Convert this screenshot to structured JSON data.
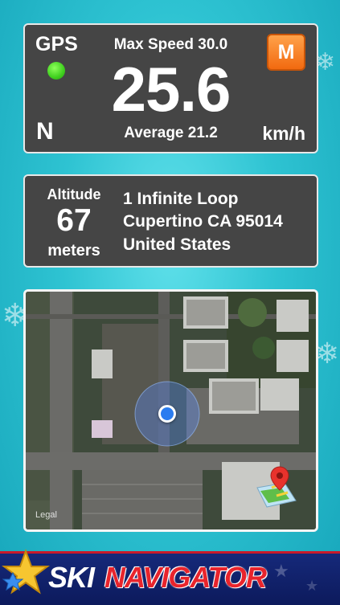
{
  "speed_panel": {
    "gps_label": "GPS",
    "heading": "N",
    "max_speed": "Max Speed 30.0",
    "speed": "25.6",
    "average": "Average 21.2",
    "unit": "km/h",
    "mode_button": "M"
  },
  "location_panel": {
    "altitude_label": "Altitude",
    "altitude_value": "67",
    "altitude_unit": "meters",
    "address_line1": "1 Infinite Loop",
    "address_line2": "Cupertino CA 95014",
    "address_line3": "United States"
  },
  "map": {
    "legal_label": "Legal",
    "location_marker_icon": "blue-location-dot-icon",
    "open_maps_icon": "maps-pin-icon"
  },
  "banner": {
    "logo_ski": "SKI",
    "logo_navigator": "NAVIGATOR",
    "logo_icon": "star-icon"
  },
  "colors": {
    "background": "#2ec3d2",
    "panel": "#454545",
    "gps_indicator": "#3fcf1e",
    "mode_button": "#f26a10",
    "banner": "#16297a",
    "brand_red": "#e8242c"
  }
}
